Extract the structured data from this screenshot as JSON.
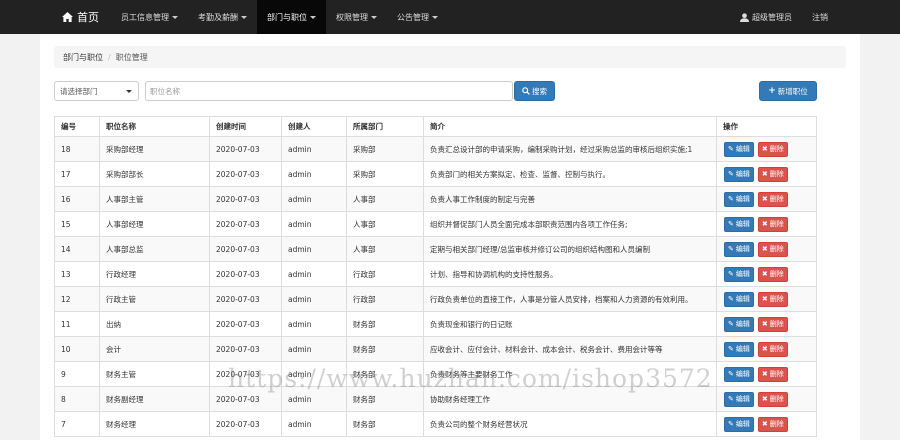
{
  "nav": {
    "home_label": "首页",
    "menus": [
      {
        "label": "员工信息管理",
        "active": false
      },
      {
        "label": "考勤及薪酬",
        "active": false
      },
      {
        "label": "部门与职位",
        "active": true
      },
      {
        "label": "权限管理",
        "active": false
      },
      {
        "label": "公告管理",
        "active": false
      }
    ],
    "user_label": "超级管理员",
    "logout_label": "注销"
  },
  "breadcrumb": {
    "parent": "部门与职位",
    "separator": "/",
    "current": "职位管理"
  },
  "toolbar": {
    "dept_select_value": "请选择部门",
    "position_name_placeholder": "职位名称",
    "search_label": "搜索",
    "add_label": "新增职位"
  },
  "table": {
    "headers": [
      "编号",
      "职位名称",
      "创建时间",
      "创建人",
      "所属部门",
      "简介",
      "操作"
    ],
    "edit_label": "编辑",
    "delete_label": "删除",
    "rows": [
      {
        "id": "18",
        "name": "采购部经理",
        "created": "2020-07-03",
        "creator": "admin",
        "dept": "采购部",
        "desc": "负责汇总设计部的申请采购，编制采购计划，经过采购总监的审核后组织实施;1"
      },
      {
        "id": "17",
        "name": "采购部部长",
        "created": "2020-07-03",
        "creator": "admin",
        "dept": "采购部",
        "desc": "负责部门的相关方案拟定、检查、监督、控制与执行。"
      },
      {
        "id": "16",
        "name": "人事部主管",
        "created": "2020-07-03",
        "creator": "admin",
        "dept": "人事部",
        "desc": "负责人事工作制度的制定与完善"
      },
      {
        "id": "15",
        "name": "人事部经理",
        "created": "2020-07-03",
        "creator": "admin",
        "dept": "人事部",
        "desc": "组织并督促部门人员全面完成本部职责范围内各项工作任务;"
      },
      {
        "id": "14",
        "name": "人事部总监",
        "created": "2020-07-03",
        "creator": "admin",
        "dept": "人事部",
        "desc": "定期与相关部门经理/总监审核并修订公司的组织结构图和人员编制"
      },
      {
        "id": "13",
        "name": "行政经理",
        "created": "2020-07-03",
        "creator": "admin",
        "dept": "行政部",
        "desc": "计划、指导和协调机构的支持性服务。"
      },
      {
        "id": "12",
        "name": "行政主管",
        "created": "2020-07-03",
        "creator": "admin",
        "dept": "行政部",
        "desc": "行政负责单位的直接工作，人事是分管人员安排，档案和人力资源的有效利用。"
      },
      {
        "id": "11",
        "name": "出纳",
        "created": "2020-07-03",
        "creator": "admin",
        "dept": "财务部",
        "desc": "负责现金和银行的日记账"
      },
      {
        "id": "10",
        "name": "会计",
        "created": "2020-07-03",
        "creator": "admin",
        "dept": "财务部",
        "desc": "应收会计、应付会计、材料会计、成本会计、税务会计、费用会计等等"
      },
      {
        "id": "9",
        "name": "财务主管",
        "created": "2020-07-03",
        "creator": "admin",
        "dept": "财务部",
        "desc": "负责财务等主要财务工作"
      },
      {
        "id": "8",
        "name": "财务副经理",
        "created": "2020-07-03",
        "creator": "admin",
        "dept": "财务部",
        "desc": "协助财务经理工作"
      },
      {
        "id": "7",
        "name": "财务经理",
        "created": "2020-07-03",
        "creator": "admin",
        "dept": "财务部",
        "desc": "负责公司的整个财务经营状况"
      }
    ]
  },
  "watermark": "https://www.huzhan.com/ishop3572"
}
